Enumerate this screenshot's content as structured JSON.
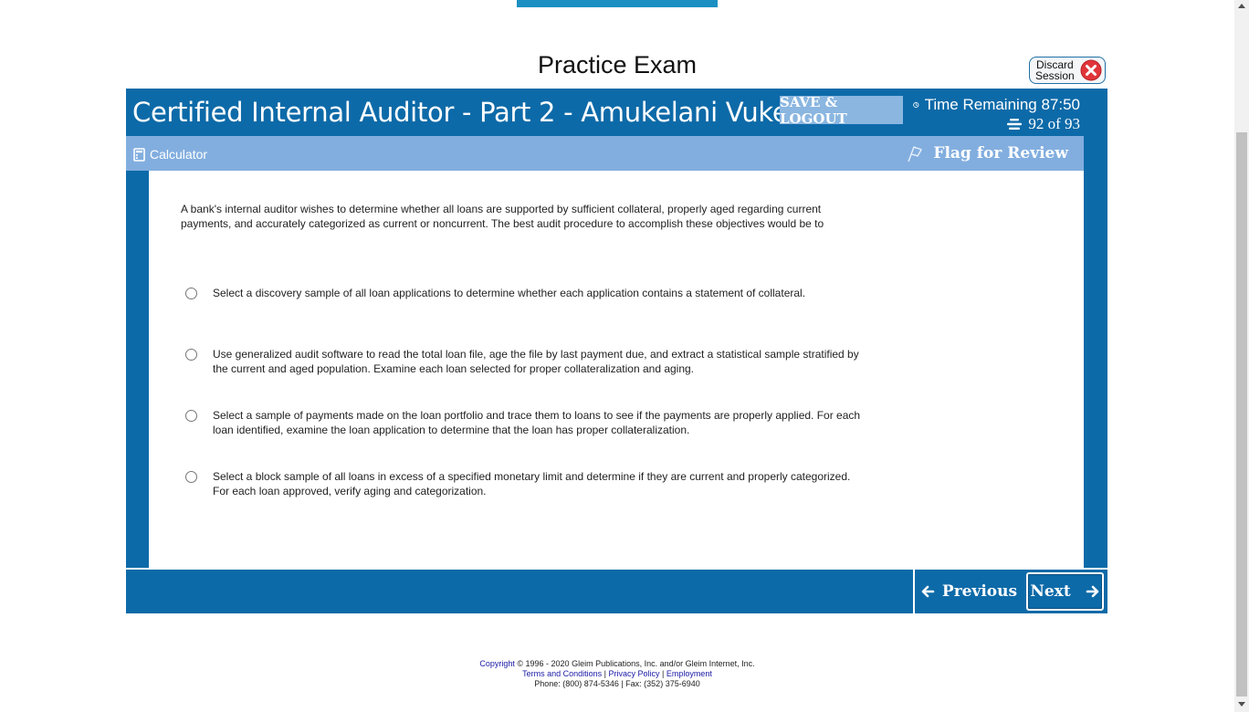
{
  "page": {
    "title": "Practice Exam"
  },
  "discard": {
    "label_line1": "Discard",
    "label_line2": "Session",
    "icon": "close-circle-icon"
  },
  "exam": {
    "title": "Certified Internal Auditor - Part 2 - Amukelani Vukela",
    "save_logout_label": "SAVE & LOGOUT",
    "time_remaining": "Time Remaining 87:50",
    "question_counter": "92 of 93"
  },
  "toolbar": {
    "calculator_label": "Calculator",
    "flag_label": "Flag for Review"
  },
  "question": {
    "text": "A bank's internal auditor wishes to determine whether all loans are supported by sufficient collateral, properly aged regarding current payments, and accurately categorized as current or noncurrent. The best audit procedure to accomplish these objectives would be to",
    "answers": [
      "Select a discovery sample of all loan applications to determine whether each application contains a statement of collateral.",
      "Use generalized audit software to read the total loan file, age the file by last payment due, and extract a statistical sample stratified by the current and aged population. Examine each loan selected for proper collateralization and aging.",
      "Select a sample of payments made on the loan portfolio and trace them to loans to see if the payments are properly applied. For each loan identified, examine the loan application to determine that the loan has proper collateralization.",
      "Select a block sample of all loans in excess of a specified monetary limit and determine if they are current and properly categorized. For each loan approved, verify aging and categorization."
    ]
  },
  "nav": {
    "previous_label": "Previous",
    "next_label": "Next"
  },
  "footer": {
    "copyright_link": "Copyright",
    "copyright_text": "© 1996 - 2020 Gleim Publications, Inc. and/or Gleim Internet, Inc.",
    "terms": "Terms and Conditions",
    "privacy": "Privacy Policy",
    "employment": "Employment",
    "sep": " | ",
    "contact": "Phone: (800) 874-5346 | Fax: (352) 375-6940"
  },
  "colors": {
    "header_blue": "#0d6aa8",
    "toolbar_blue": "#82aedf",
    "save_btn": "#8ab6e0",
    "discard_red": "#e0353a"
  }
}
